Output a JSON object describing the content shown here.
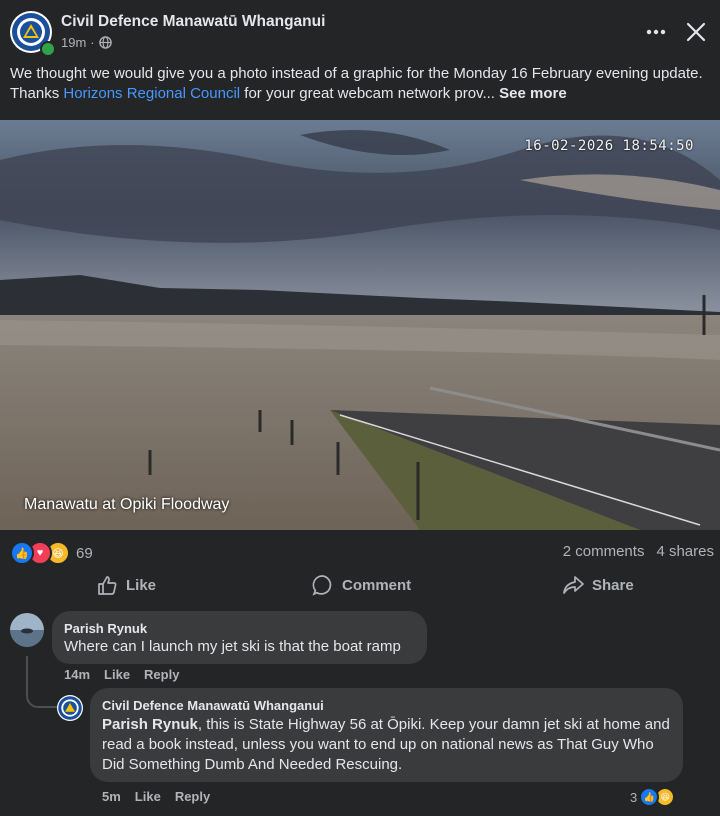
{
  "post": {
    "page_name": "Civil Defence Manawatū Whanganui",
    "time": "19m",
    "audience_icon": "globe-icon",
    "caption_before": "We thought we would give you a photo instead of a graphic for the Monday 16 February evening update. Thanks ",
    "caption_link": "Horizons Regional Council",
    "caption_after": " for your great webcam network prov... ",
    "see_more": "See more"
  },
  "photo": {
    "timestamp": "16-02-2026 18:54:50",
    "caption": "Manawatu at Opiki Floodway"
  },
  "reactions": {
    "types": [
      "like",
      "love",
      "haha"
    ],
    "count": "69",
    "comments": "2 comments",
    "shares": "4 shares"
  },
  "actions": {
    "like": "Like",
    "comment": "Comment",
    "share": "Share"
  },
  "comments": [
    {
      "author": "Parish Rynuk",
      "text": "Where can I launch my jet ski is that the boat ramp",
      "time": "14m",
      "like": "Like",
      "reply": "Reply"
    },
    {
      "author": "Civil Defence Manawatū Whanganui",
      "mention": "Parish Rynuk",
      "text": ", this is State Highway 56 at Ōpiki. Keep your damn jet ski at home and read a book instead, unless you want to end up on national news as That Guy Who Did Something Dumb And Needed Rescuing.",
      "time": "5m",
      "like": "Like",
      "reply": "Reply",
      "reaction_count": "3"
    }
  ],
  "colors": {
    "background": "#242526",
    "bubble": "#3a3b3c",
    "link": "#4599ff",
    "like_blue": "#1877f2",
    "love_red": "#f33e58",
    "online_green": "#31a24c"
  }
}
